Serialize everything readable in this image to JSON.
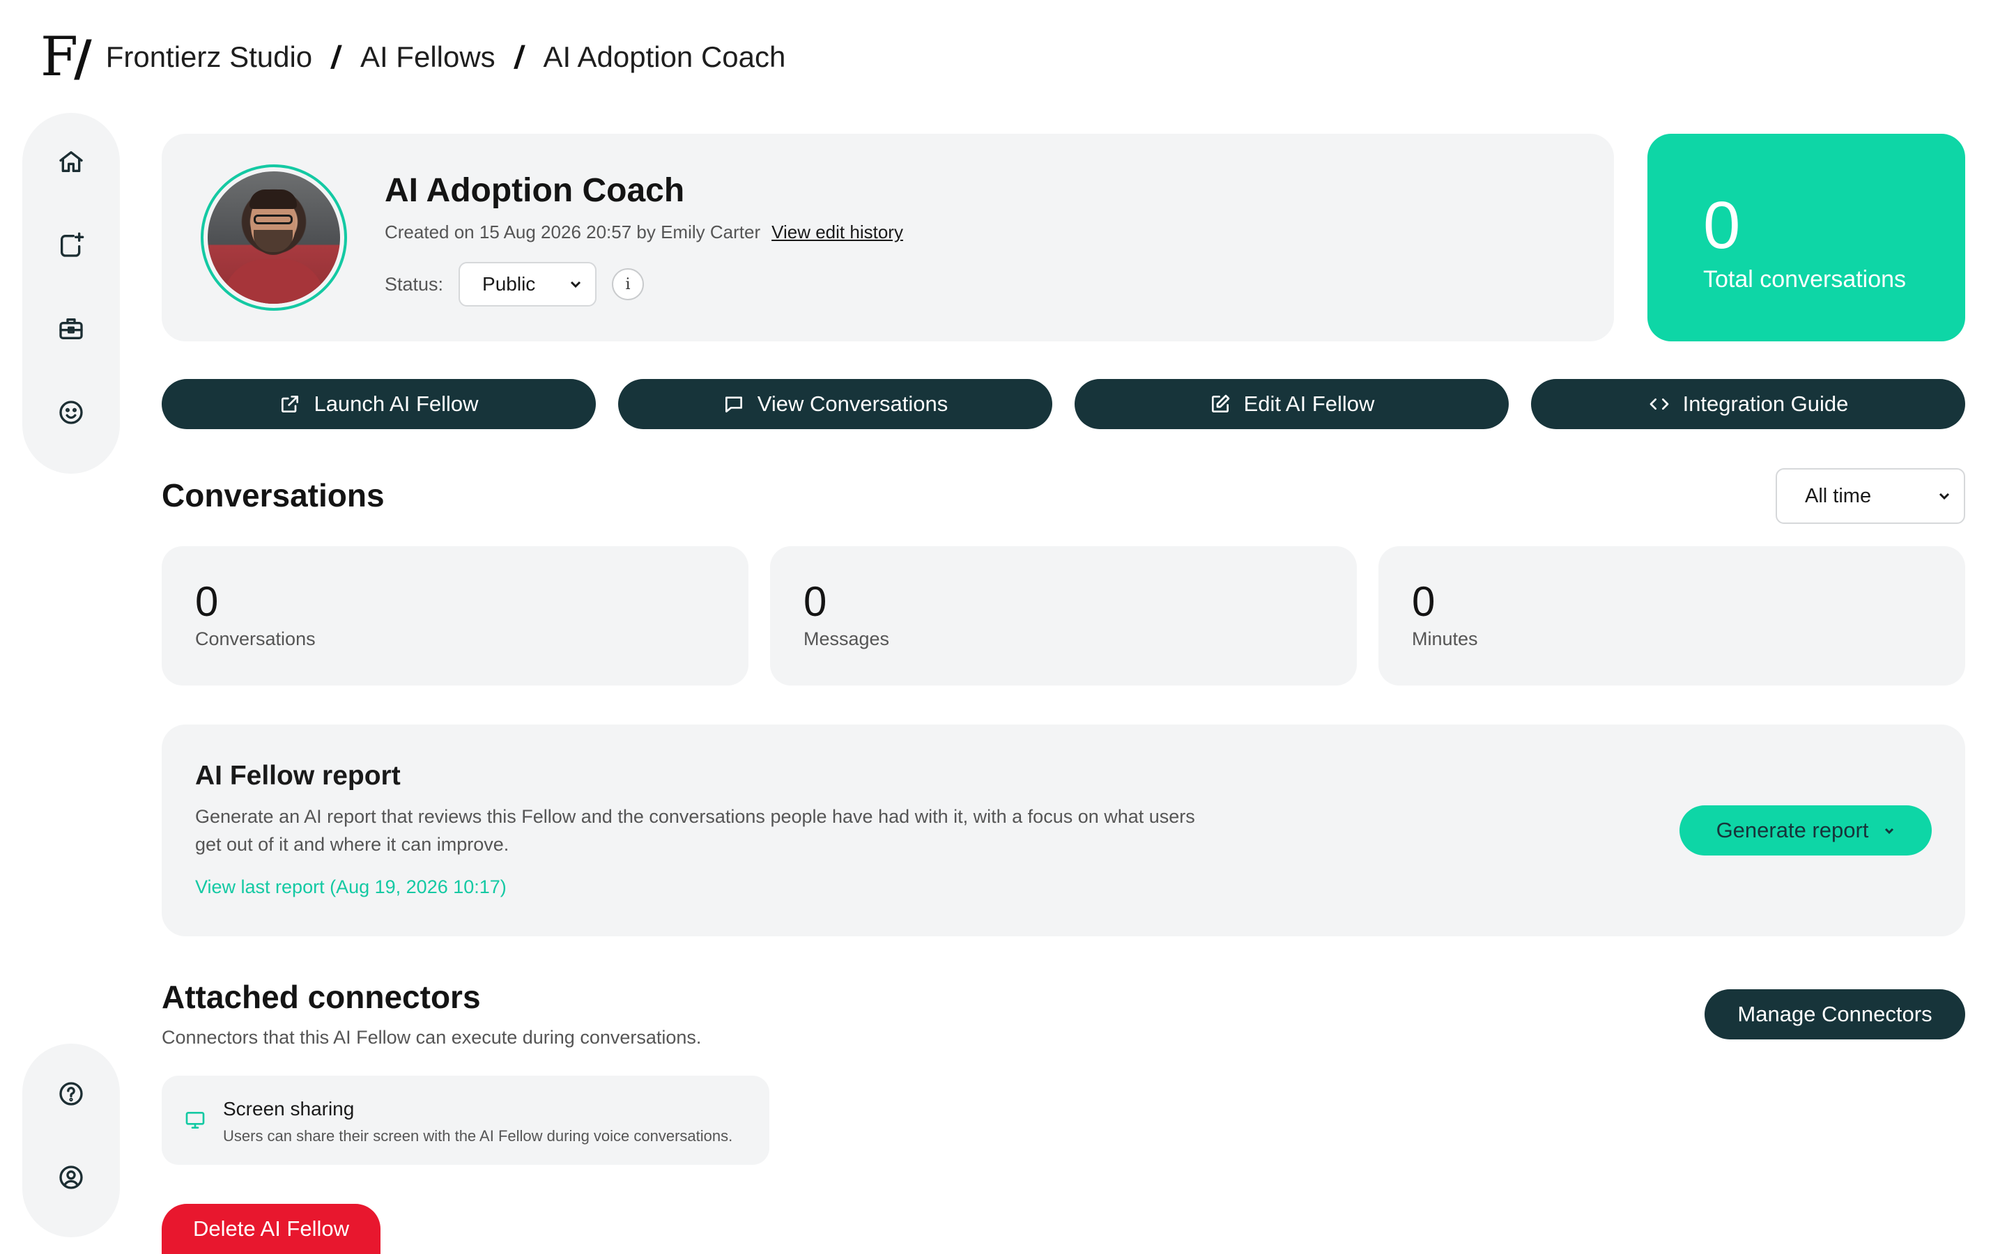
{
  "breadcrumb": {
    "logo": "F/",
    "items": [
      "Frontierz Studio",
      "AI Fellows",
      "AI Adoption Coach"
    ]
  },
  "sidebar": {
    "top": [
      "home-icon",
      "new-item-icon",
      "briefcase-icon",
      "smiley-icon"
    ],
    "bottom": [
      "help-icon",
      "account-icon"
    ]
  },
  "profile": {
    "title": "AI Adoption Coach",
    "created": "Created on 15 Aug 2026 20:57 by Emily Carter",
    "history_link": "View edit history",
    "status_label": "Status:",
    "status_value": "Public",
    "info_glyph": "i"
  },
  "total": {
    "value": "0",
    "label": "Total conversations"
  },
  "actions": {
    "launch": "Launch AI Fellow",
    "view_conversations": "View Conversations",
    "edit": "Edit AI Fellow",
    "integration": "Integration Guide"
  },
  "conversations": {
    "title": "Conversations",
    "range": "All time",
    "stats": [
      {
        "value": "0",
        "label": "Conversations"
      },
      {
        "value": "0",
        "label": "Messages"
      },
      {
        "value": "0",
        "label": "Minutes"
      }
    ]
  },
  "report": {
    "title": "AI Fellow report",
    "description": "Generate an AI report that reviews this Fellow and the conversations people have had with it, with a focus on what users get out of it and where it can improve.",
    "last_link": "View last report (Aug 19, 2026 10:17)",
    "generate_label": "Generate report"
  },
  "connectors": {
    "title": "Attached connectors",
    "subtitle": "Connectors that this AI Fellow can execute during conversations.",
    "manage_label": "Manage Connectors",
    "items": [
      {
        "name": "Screen sharing",
        "description": "Users can share their screen with the AI Fellow during voice conversations."
      }
    ]
  },
  "danger": {
    "delete_label": "Delete AI Fellow"
  },
  "colors": {
    "accent": "#0ed6a6",
    "dark": "#17343a",
    "danger": "#e8172e",
    "surface": "#f3f4f5"
  }
}
